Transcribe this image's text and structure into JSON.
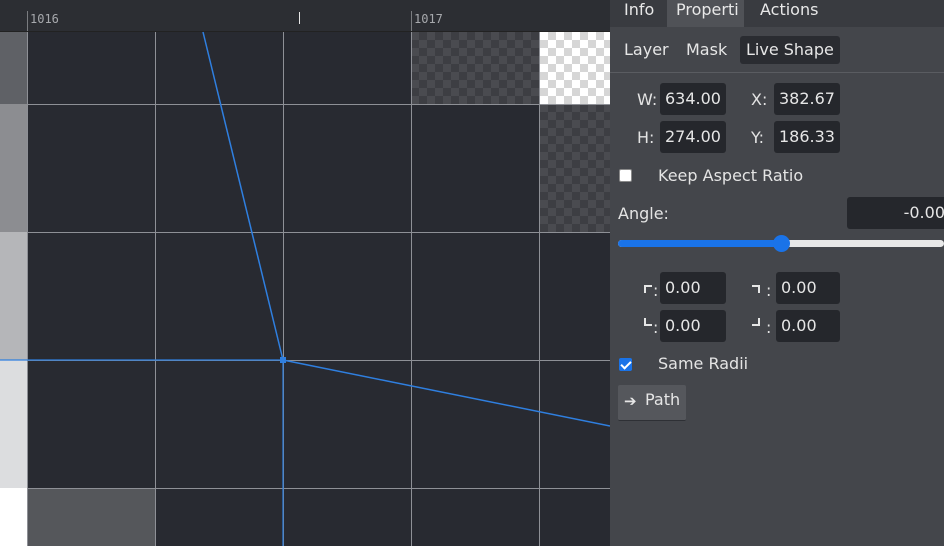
{
  "ruler": {
    "labels": [
      "1016",
      "1017"
    ]
  },
  "tabs": [
    {
      "label": "Info",
      "active": false
    },
    {
      "label": "Properti",
      "active": true
    },
    {
      "label": "Actions",
      "active": false
    }
  ],
  "subtabs": [
    {
      "label": "Layer",
      "active": false
    },
    {
      "label": "Mask",
      "active": false
    },
    {
      "label": "Live Shape",
      "active": true
    }
  ],
  "dimensions": {
    "w_label": "W:",
    "w_value": "634.00",
    "x_label": "X:",
    "x_value": "382.67",
    "h_label": "H:",
    "h_value": "274.00",
    "y_label": "Y:",
    "y_value": "186.33"
  },
  "keep_aspect": {
    "label": "Keep Aspect Ratio",
    "checked": false
  },
  "angle": {
    "label": "Angle:",
    "value": "-0.00",
    "slider_fraction": 0.5
  },
  "radii": {
    "top_left": "0.00",
    "top_right": "0.00",
    "bottom_left": "0.00",
    "bottom_right": "0.00",
    "separator": ":"
  },
  "same_radii": {
    "label": "Same Radii",
    "checked": true
  },
  "path_button": {
    "arrow": "➔",
    "label": "Path"
  },
  "colors": {
    "accent": "#1a73e8",
    "guide": "#2f7fe0",
    "panel": "#44464b",
    "canvas": "#282a31"
  },
  "icons": [
    "corner-top-left-icon",
    "corner-top-right-icon",
    "corner-bottom-left-icon",
    "corner-bottom-right-icon",
    "arrow-right-icon"
  ]
}
